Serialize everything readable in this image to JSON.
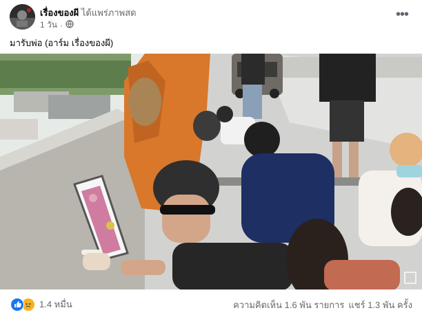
{
  "post": {
    "page_name": "เรื่องของผี",
    "action_text": "ได้แพร่ภาพสด",
    "timestamp": "1 วัน",
    "privacy_icon": "globe-icon",
    "more_icon": "more-horizontal-icon",
    "caption": "มารับพ่อ (อาร์ม เรื่องของผี)"
  },
  "video": {
    "scene": "live-video-frame",
    "overlay_icon": "fullscreen-icon"
  },
  "footer": {
    "reaction_icons": [
      "like-icon",
      "sad-icon"
    ],
    "reaction_count": "1.4 หมื่น",
    "comments": "ความคิดเห็น 1.6 พัน รายการ",
    "shares": "แชร์ 1.3 พัน ครั้ง"
  },
  "colors": {
    "like": "#1877f2",
    "sad": "#f7b125",
    "muted_text": "#65676b",
    "robe": "#d9782a",
    "sky": "#e6ebe8"
  }
}
